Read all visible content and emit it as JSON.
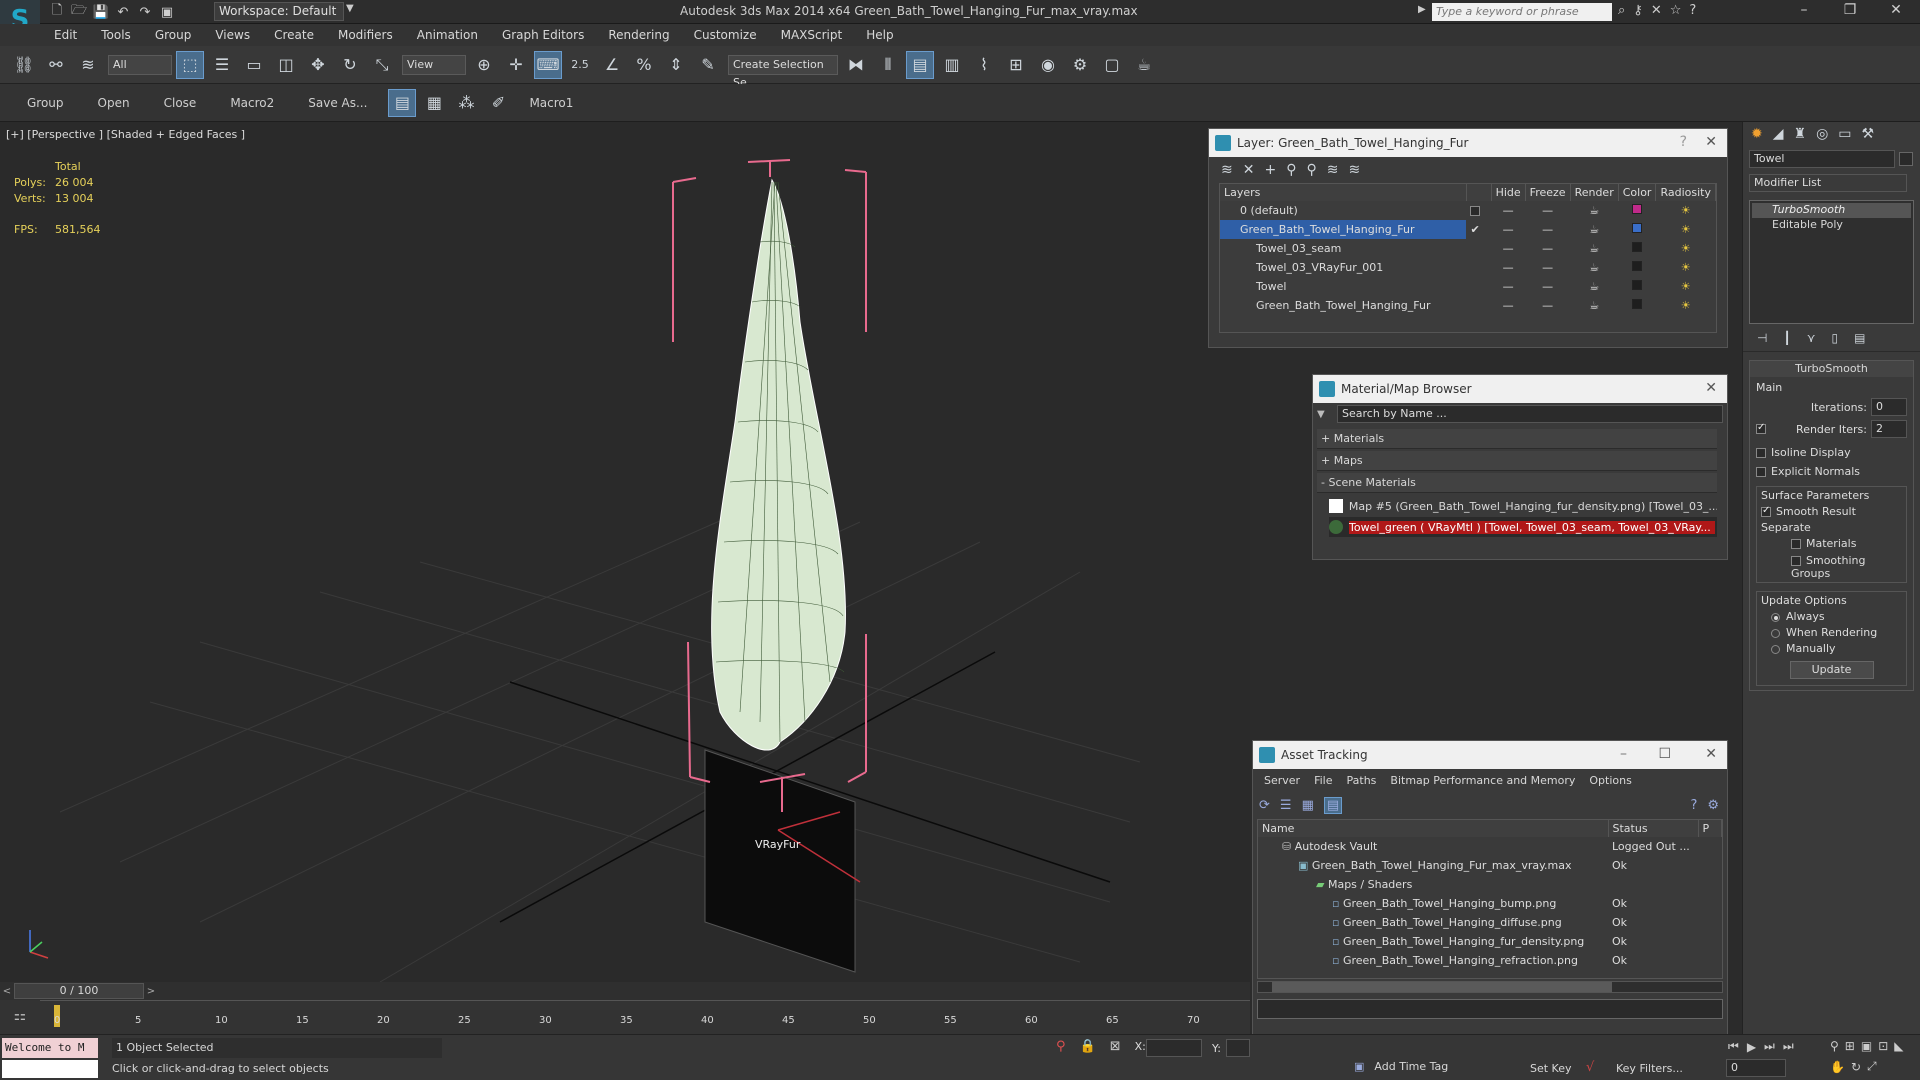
{
  "titlebar": {
    "workspace": "Workspace: Default",
    "app_title": "Autodesk 3ds Max  2014 x64     Green_Bath_Towel_Hanging_Fur_max_vray.max",
    "search_placeholder": "Type a keyword or phrase"
  },
  "menu": [
    "Edit",
    "Tools",
    "Group",
    "Views",
    "Create",
    "Modifiers",
    "Animation",
    "Graph Editors",
    "Rendering",
    "Customize",
    "MAXScript",
    "Help"
  ],
  "toolbar": {
    "filter": "All",
    "refcoord": "View",
    "snap_value": "2.5",
    "selection_set": "Create Selection Se"
  },
  "bar2": [
    "Group",
    "Open",
    "Close",
    "Macro2",
    "Save As...",
    "Macro1"
  ],
  "viewport": {
    "label": "[+] [Perspective ] [Shaded + Edged Faces ]",
    "stats_header": "Total",
    "polys_label": "Polys:",
    "polys": "26 004",
    "verts_label": "Verts:",
    "verts": "13 004",
    "fps_label": "FPS:",
    "fps": "581,564",
    "object_label": "VRayFur"
  },
  "layer_panel": {
    "title": "Layer: Green_Bath_Towel_Hanging_Fur",
    "headers": [
      "Layers",
      "Hide",
      "Freeze",
      "Render",
      "Color",
      "Radiosity"
    ],
    "rows": [
      {
        "name": "0 (default)",
        "color": "#c02a8a"
      },
      {
        "name": "Green_Bath_Towel_Hanging_Fur",
        "color": "#3a6ec8"
      },
      {
        "name": "Towel_03_seam",
        "color": "#1e1e1e"
      },
      {
        "name": "Towel_03_VRayFur_001",
        "color": "#1e1e1e"
      },
      {
        "name": "Towel",
        "color": "#1e1e1e"
      },
      {
        "name": "Green_Bath_Towel_Hanging_Fur",
        "color": "#1e1e1e"
      }
    ]
  },
  "material_browser": {
    "title": "Material/Map Browser",
    "search": "Search by Name ...",
    "groups": [
      "+ Materials",
      "+ Maps",
      "- Scene Materials"
    ],
    "items": [
      "Map #5 (Green_Bath_Towel_Hanging_fur_density.png) [Towel_03_...",
      "Towel_green  ( VRayMtl )  [Towel, Towel_03_seam, Towel_03_VRay..."
    ]
  },
  "asset_tracking": {
    "title": "Asset Tracking",
    "menu": [
      "Server",
      "File",
      "Paths",
      "Bitmap Performance and Memory",
      "Options"
    ],
    "headers": [
      "Name",
      "Status",
      "P"
    ],
    "rows": [
      {
        "name": "Autodesk Vault",
        "status": "Logged Out ..."
      },
      {
        "name": "Green_Bath_Towel_Hanging_Fur_max_vray.max",
        "status": "Ok"
      },
      {
        "name": "Maps / Shaders",
        "status": ""
      },
      {
        "name": "Green_Bath_Towel_Hanging_bump.png",
        "status": "Ok"
      },
      {
        "name": "Green_Bath_Towel_Hanging_diffuse.png",
        "status": "Ok"
      },
      {
        "name": "Green_Bath_Towel_Hanging_fur_density.png",
        "status": "Ok"
      },
      {
        "name": "Green_Bath_Towel_Hanging_refraction.png",
        "status": "Ok"
      }
    ]
  },
  "command_panel": {
    "object_name": "Towel",
    "modifier_list": "Modifier List",
    "stack": [
      "TurboSmooth",
      "Editable Poly"
    ],
    "rollout_title": "TurboSmooth",
    "main_label": "Main",
    "iterations_label": "Iterations:",
    "iterations": "0",
    "render_iters_label": "Render Iters:",
    "render_iters": "2",
    "isoline": "Isoline Display",
    "explicit_normals": "Explicit Normals",
    "surface_params": "Surface Parameters",
    "smooth_result": "Smooth Result",
    "separate": "Separate",
    "materials": "Materials",
    "smoothing_groups": "Smoothing Groups",
    "update_options": "Update Options",
    "always": "Always",
    "when_rendering": "When Rendering",
    "manually": "Manually",
    "update_btn": "Update"
  },
  "timeline": {
    "frame_counter": "0 / 100",
    "ticks": [
      "0",
      "5",
      "10",
      "15",
      "20",
      "25",
      "30",
      "35",
      "40",
      "45",
      "50",
      "55",
      "60",
      "65",
      "70"
    ]
  },
  "status": {
    "welcome": "Welcome to M",
    "selected": "1 Object Selected",
    "prompt": "Click or click-and-drag to select objects",
    "x_label": "X:",
    "y_label": "Y:",
    "add_time_tag": "Add Time Tag",
    "set_key": "Set Key",
    "key_filters": "Key Filters...",
    "frame": "0"
  }
}
